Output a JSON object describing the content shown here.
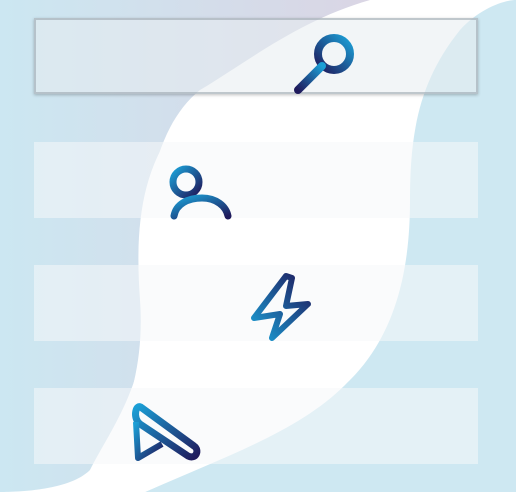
{
  "search": {
    "icon": "search-icon"
  },
  "menu": {
    "items": [
      {
        "icon": "user-icon"
      },
      {
        "icon": "lightning-bolt-icon"
      },
      {
        "icon": "pencil-icon"
      }
    ]
  },
  "colors": {
    "icon_gradient_start": "#1b9fd6",
    "icon_gradient_end": "#1f1a5c",
    "backdrop": "#cfe8f2",
    "panel_border": "#9aa0a8"
  }
}
